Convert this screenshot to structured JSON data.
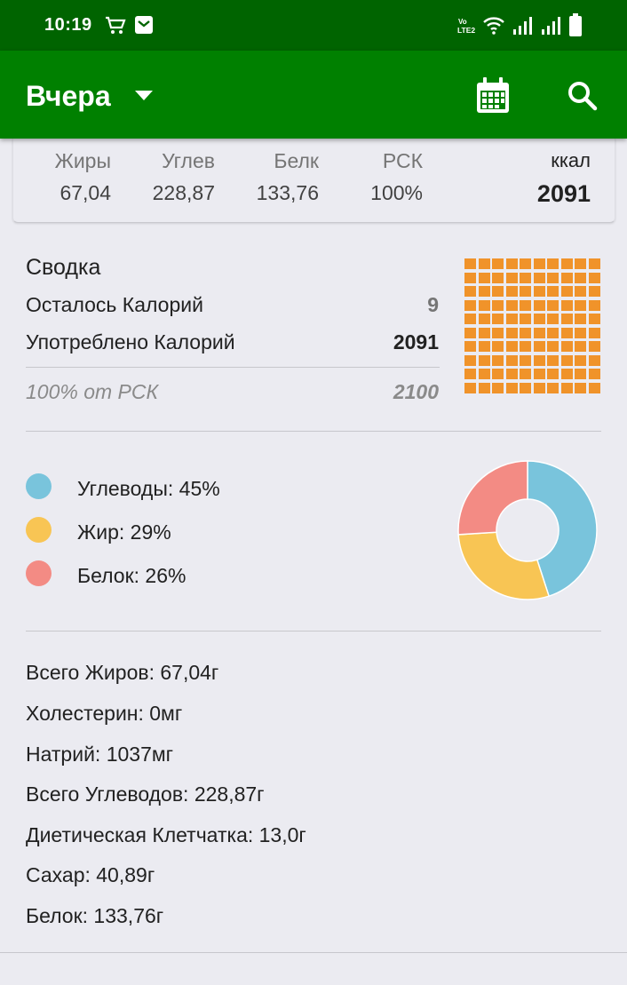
{
  "status_bar": {
    "time": "10:19"
  },
  "app_bar": {
    "title": "Вчера"
  },
  "macros": {
    "fat": {
      "label": "Жиры",
      "value": "67,04"
    },
    "carbs": {
      "label": "Углев",
      "value": "228,87"
    },
    "protein": {
      "label": "Белк",
      "value": "133,76"
    },
    "rdi": {
      "label": "РСК",
      "value": "100%"
    },
    "kcal": {
      "label": "ккал",
      "value": "2091"
    }
  },
  "summary": {
    "title": "Сводка",
    "remaining_label": "Осталось Калорий",
    "remaining_value": "9",
    "consumed_label": "Употреблено Калорий",
    "consumed_value": "2091",
    "rdi_label": "100% от РСК",
    "rdi_value": "2100",
    "grid_fill_fraction": 1.0,
    "grid_color": "#f0932a"
  },
  "chart_data": {
    "type": "pie",
    "categories": [
      "Углеводы",
      "Жир",
      "Белок"
    ],
    "values": [
      45,
      29,
      26
    ],
    "colors": [
      "#79c4dc",
      "#f8c554",
      "#f38b84"
    ],
    "legend": [
      "Углеводы: 45%",
      "Жир: 29%",
      "Белок: 26%"
    ],
    "donut": true
  },
  "nutrients": [
    "Всего Жиров: 67,04г",
    "Холестерин: 0мг",
    "Натрий: 1037мг",
    "Всего Углеводов: 228,87г",
    "Диетическая Клетчатка: 13,0г",
    "Сахар: 40,89г",
    "Белок: 133,76г"
  ],
  "colors": {
    "status_bar": "#006400",
    "app_bar": "#008000",
    "background": "#ebebf1"
  },
  "icons": {
    "cart": "cart-icon",
    "notification": "mail-notification-icon",
    "volte": "volte-icon",
    "wifi": "wifi-icon",
    "signal": "signal-icon",
    "battery": "battery-icon",
    "dropdown": "dropdown-arrow-icon",
    "calendar": "calendar-icon",
    "search": "search-icon"
  }
}
